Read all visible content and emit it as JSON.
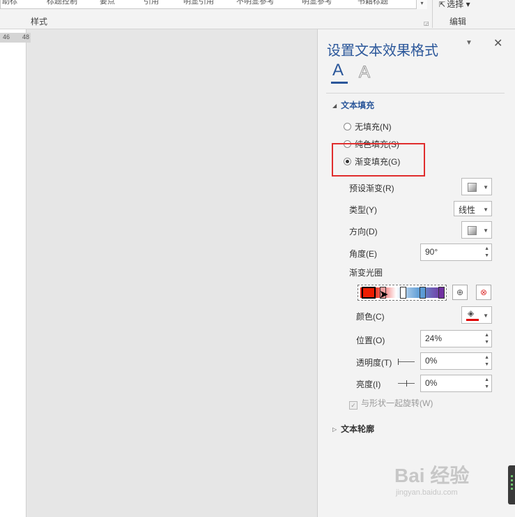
{
  "ribbon": {
    "gallery_items": [
      "助标",
      "标题控制",
      "要点",
      "引用",
      "明显引用",
      "不明显参考",
      "明显参考",
      "书籍标题"
    ],
    "styles_group_label": "样式",
    "select_label": "选择",
    "edit_group_label": "编辑"
  },
  "ruler": {
    "ticks": [
      "46",
      "48"
    ]
  },
  "pane": {
    "title": "设置文本效果格式",
    "menu_arrow": "▼",
    "close": "✕",
    "tab_fill_glyph": "A",
    "tab_effects_glyph": "A",
    "text_fill_section": "文本填充",
    "fill_options": [
      {
        "label": "无填充(N)",
        "checked": false
      },
      {
        "label": "纯色填充(S)",
        "checked": false
      },
      {
        "label": "渐变填充(G)",
        "checked": true
      }
    ],
    "preset_gradient_label": "预设渐变(R)",
    "type_label": "类型(Y)",
    "type_value": "线性",
    "direction_label": "方向(D)",
    "angle_label": "角度(E)",
    "angle_value": "90°",
    "gradient_stops_label": "渐变光圈",
    "gradient_stop_colors": [
      "#ee1c00",
      "#ee1c00",
      "#f08080",
      "#ffffff",
      "#9dc3e6",
      "#5b9bd5",
      "#6f5fb6",
      "#7030a0"
    ],
    "color_label": "颜色(C)",
    "color_value": "#e00000",
    "position_label": "位置(O)",
    "position_value": "24%",
    "transparency_label": "透明度(T)",
    "transparency_value": "0%",
    "brightness_label": "亮度(I)",
    "brightness_value": "0%",
    "rotate_with_shape_label": "与形状一起旋转(W)",
    "rotate_with_shape_checked": true,
    "text_outline_section": "文本轮廓"
  },
  "watermark": {
    "brand": "Bai 经验",
    "url": "jingyan.baidu.com"
  }
}
